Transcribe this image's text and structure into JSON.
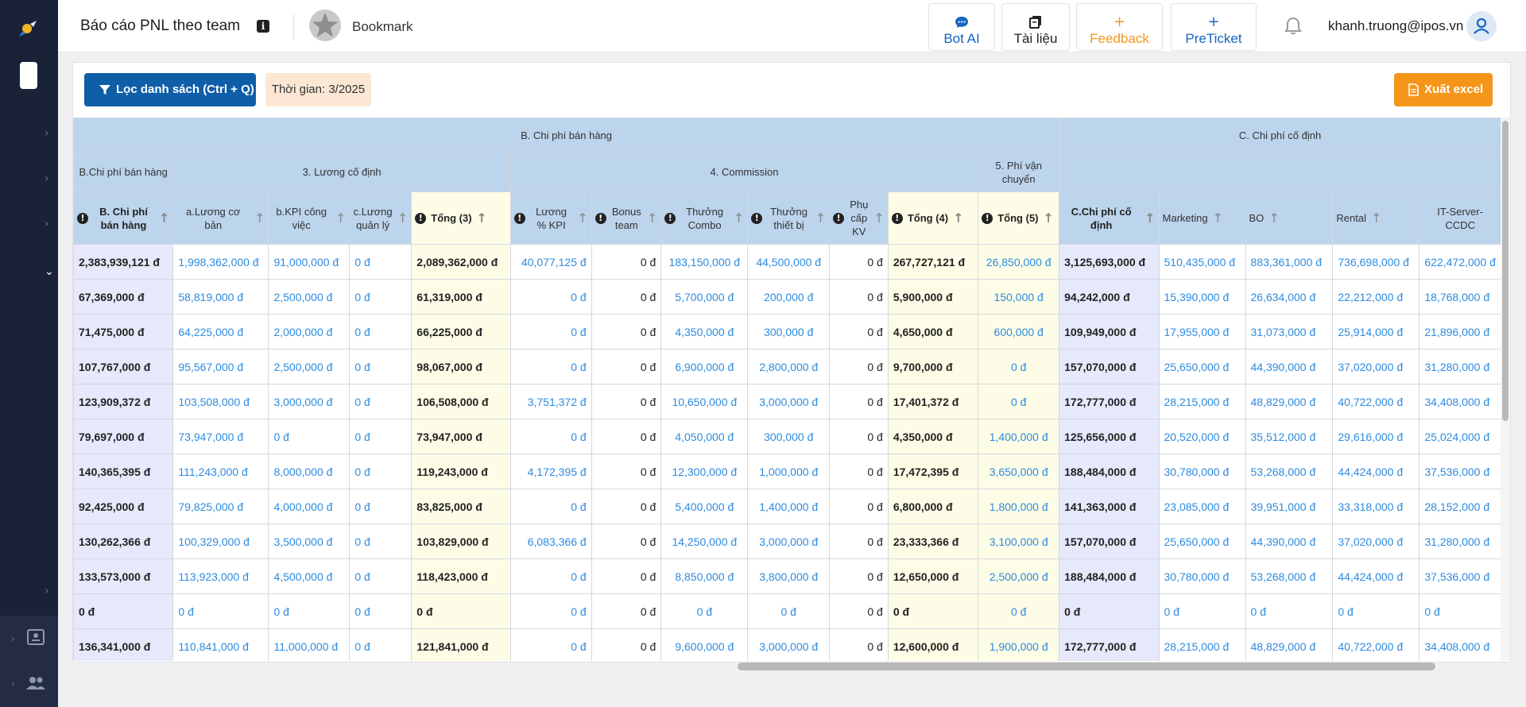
{
  "header": {
    "title": "Báo cáo PNL theo team",
    "bookmark_label": "Bookmark",
    "buttons": [
      {
        "label": "Bot AI",
        "icon": "chat-bubble-icon",
        "color": "#1565c0"
      },
      {
        "label": "Tài liệu",
        "icon": "document-stack-icon",
        "color": "#222222"
      },
      {
        "label": "Feedback",
        "icon": "plus-icon",
        "color": "#f5951a"
      },
      {
        "label": "PreTicket",
        "icon": "plus-icon",
        "color": "#1565c0"
      }
    ],
    "user_email": "khanh.truong@ipos.vn"
  },
  "toolbar": {
    "filter_label": "Lọc danh sách (Ctrl + Q)",
    "time_label": "Thời gian: 3/2025",
    "export_label": "Xuất excel"
  },
  "colors": {
    "primary": "#0f5ea8",
    "accent": "#f5951a",
    "link": "#2d8be0",
    "header_bg": "#bcd4ec",
    "sidebar_bg": "#1a2238"
  },
  "table": {
    "group_headers": {
      "b": "B. Chi phí bán hàng",
      "c": "C. Chi phí cố định"
    },
    "sub_headers": {
      "b_total": "B.Chi phí bán hàng",
      "fixed_salary": "3. Lương cố định",
      "commission": "4. Commission",
      "shipping": "5. Phí vận chuyển"
    },
    "columns": [
      "B. Chi phí bán hàng",
      "a.Lương cơ bản",
      "b.KPI công việc",
      "c.Lương quản lý",
      "Tổng (3)",
      "Lương % KPI",
      "Bonus team",
      "Thưởng Combo",
      "Thưởng thiết bị",
      "Phụ cấp KV",
      "Tổng (4)",
      "Tổng (5)",
      "C.Chi phí cố định",
      "Marketing",
      "BO",
      "Rental",
      "IT-Server-CCDC"
    ],
    "rows": [
      [
        "2,383,939,121 đ",
        "1,998,362,000 đ",
        "91,000,000 đ",
        "0 đ",
        "2,089,362,000 đ",
        "40,077,125 đ",
        "0 đ",
        "183,150,000 đ",
        "44,500,000 đ",
        "0 đ",
        "267,727,121 đ",
        "26,850,000 đ",
        "3,125,693,000 đ",
        "510,435,000 đ",
        "883,361,000 đ",
        "736,698,000 đ",
        "622,472,000 đ"
      ],
      [
        "67,369,000 đ",
        "58,819,000 đ",
        "2,500,000 đ",
        "0 đ",
        "61,319,000 đ",
        "0 đ",
        "0 đ",
        "5,700,000 đ",
        "200,000 đ",
        "0 đ",
        "5,900,000 đ",
        "150,000 đ",
        "94,242,000 đ",
        "15,390,000 đ",
        "26,634,000 đ",
        "22,212,000 đ",
        "18,768,000 đ"
      ],
      [
        "71,475,000 đ",
        "64,225,000 đ",
        "2,000,000 đ",
        "0 đ",
        "66,225,000 đ",
        "0 đ",
        "0 đ",
        "4,350,000 đ",
        "300,000 đ",
        "0 đ",
        "4,650,000 đ",
        "600,000 đ",
        "109,949,000 đ",
        "17,955,000 đ",
        "31,073,000 đ",
        "25,914,000 đ",
        "21,896,000 đ"
      ],
      [
        "107,767,000 đ",
        "95,567,000 đ",
        "2,500,000 đ",
        "0 đ",
        "98,067,000 đ",
        "0 đ",
        "0 đ",
        "6,900,000 đ",
        "2,800,000 đ",
        "0 đ",
        "9,700,000 đ",
        "0 đ",
        "157,070,000 đ",
        "25,650,000 đ",
        "44,390,000 đ",
        "37,020,000 đ",
        "31,280,000 đ"
      ],
      [
        "123,909,372 đ",
        "103,508,000 đ",
        "3,000,000 đ",
        "0 đ",
        "106,508,000 đ",
        "3,751,372 đ",
        "0 đ",
        "10,650,000 đ",
        "3,000,000 đ",
        "0 đ",
        "17,401,372 đ",
        "0 đ",
        "172,777,000 đ",
        "28,215,000 đ",
        "48,829,000 đ",
        "40,722,000 đ",
        "34,408,000 đ"
      ],
      [
        "79,697,000 đ",
        "73,947,000 đ",
        "0 đ",
        "0 đ",
        "73,947,000 đ",
        "0 đ",
        "0 đ",
        "4,050,000 đ",
        "300,000 đ",
        "0 đ",
        "4,350,000 đ",
        "1,400,000 đ",
        "125,656,000 đ",
        "20,520,000 đ",
        "35,512,000 đ",
        "29,616,000 đ",
        "25,024,000 đ"
      ],
      [
        "140,365,395 đ",
        "111,243,000 đ",
        "8,000,000 đ",
        "0 đ",
        "119,243,000 đ",
        "4,172,395 đ",
        "0 đ",
        "12,300,000 đ",
        "1,000,000 đ",
        "0 đ",
        "17,472,395 đ",
        "3,650,000 đ",
        "188,484,000 đ",
        "30,780,000 đ",
        "53,268,000 đ",
        "44,424,000 đ",
        "37,536,000 đ"
      ],
      [
        "92,425,000 đ",
        "79,825,000 đ",
        "4,000,000 đ",
        "0 đ",
        "83,825,000 đ",
        "0 đ",
        "0 đ",
        "5,400,000 đ",
        "1,400,000 đ",
        "0 đ",
        "6,800,000 đ",
        "1,800,000 đ",
        "141,363,000 đ",
        "23,085,000 đ",
        "39,951,000 đ",
        "33,318,000 đ",
        "28,152,000 đ"
      ],
      [
        "130,262,366 đ",
        "100,329,000 đ",
        "3,500,000 đ",
        "0 đ",
        "103,829,000 đ",
        "6,083,366 đ",
        "0 đ",
        "14,250,000 đ",
        "3,000,000 đ",
        "0 đ",
        "23,333,366 đ",
        "3,100,000 đ",
        "157,070,000 đ",
        "25,650,000 đ",
        "44,390,000 đ",
        "37,020,000 đ",
        "31,280,000 đ"
      ],
      [
        "133,573,000 đ",
        "113,923,000 đ",
        "4,500,000 đ",
        "0 đ",
        "118,423,000 đ",
        "0 đ",
        "0 đ",
        "8,850,000 đ",
        "3,800,000 đ",
        "0 đ",
        "12,650,000 đ",
        "2,500,000 đ",
        "188,484,000 đ",
        "30,780,000 đ",
        "53,268,000 đ",
        "44,424,000 đ",
        "37,536,000 đ"
      ],
      [
        "0 đ",
        "0 đ",
        "0 đ",
        "0 đ",
        "0 đ",
        "0 đ",
        "0 đ",
        "0 đ",
        "0 đ",
        "0 đ",
        "0 đ",
        "0 đ",
        "0 đ",
        "0 đ",
        "0 đ",
        "0 đ",
        "0 đ"
      ],
      [
        "136,341,000 đ",
        "110,841,000 đ",
        "11,000,000 đ",
        "0 đ",
        "121,841,000 đ",
        "0 đ",
        "0 đ",
        "9,600,000 đ",
        "3,000,000 đ",
        "0 đ",
        "12,600,000 đ",
        "1,900,000 đ",
        "172,777,000 đ",
        "28,215,000 đ",
        "48,829,000 đ",
        "40,722,000 đ",
        "34,408,000 đ"
      ]
    ]
  }
}
